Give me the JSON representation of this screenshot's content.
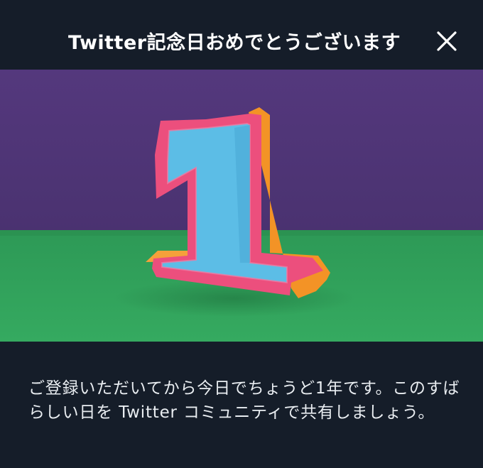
{
  "header": {
    "title": "Twitter記念日おめでとうございます",
    "close_icon": "close-icon"
  },
  "hero": {
    "illustration": "number-one-anniversary-illustration",
    "digit": "1",
    "colors": {
      "wall": "#4e3575",
      "floor": "#2fa259",
      "digit_face": "#5bbde6",
      "digit_border": "#ef4f7e",
      "digit_side": "#f5962a"
    }
  },
  "message": {
    "text": "ご登録いただいてから今日でちょうど1年です。このすばらしい日を Twitter コミュニティで共有しましょう。"
  },
  "colors": {
    "background": "#151d29",
    "text": "#e9edf1"
  }
}
